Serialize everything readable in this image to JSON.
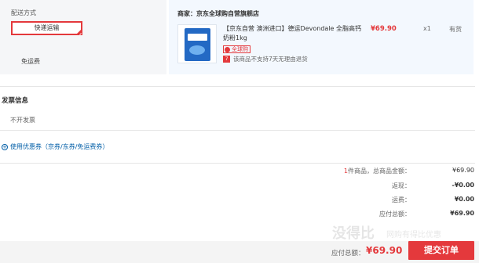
{
  "shipping": {
    "heading": "配送方式",
    "option": "快递运输",
    "free_shipping": "免运费"
  },
  "goods": {
    "seller_prefix": "商家：",
    "seller_name": "京东全球购自营旗舰店",
    "product_name": "【京东自营 澳洲进口】德运Devondale 全脂高钙奶粉1kg",
    "global_tag": "全球购",
    "no_return_icon": "7",
    "no_return": "该商品不支持7天无理由退货",
    "price": "¥69.90",
    "qty": "x1",
    "stock": "有货"
  },
  "invoice": {
    "title": "发票信息",
    "value": "不开发票"
  },
  "coupon": {
    "icon": "plus-circle-icon",
    "label": "使用优惠券（京券/东券/免运费券）"
  },
  "summary": {
    "count": "1",
    "count_suffix": "件商品，总商品金额：",
    "count_value": "¥69.90",
    "rebate_label": "返现：",
    "rebate_value": "-¥0.00",
    "freight_label": "运费：",
    "freight_value": "¥0.00",
    "total_label": "应付总额：",
    "total_value": "¥69.90"
  },
  "footer": {
    "pay_label": "应付总额：",
    "pay_amount": "¥69.90",
    "submit": "提交订单"
  },
  "watermark": {
    "text": "没得比",
    "sub": "网购有得比优惠"
  },
  "colors": {
    "accent": "#e4393c",
    "link": "#005ea7"
  }
}
